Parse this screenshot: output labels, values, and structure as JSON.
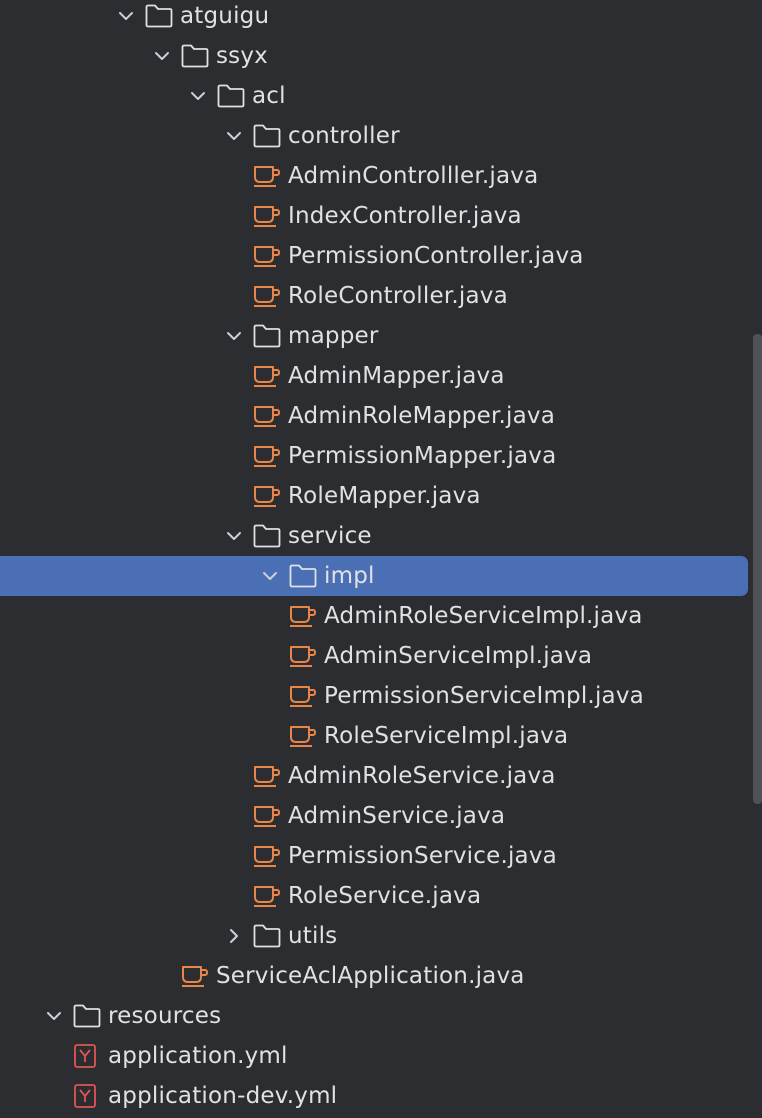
{
  "project_tree": {
    "items": [
      {
        "label": "atguigu",
        "type": "folder",
        "expanded": true,
        "depth": 3,
        "icon": "folder-icon",
        "name": "folder-atguigu"
      },
      {
        "label": "ssyx",
        "type": "folder",
        "expanded": true,
        "depth": 4,
        "icon": "folder-icon",
        "name": "folder-ssyx"
      },
      {
        "label": "acl",
        "type": "folder",
        "expanded": true,
        "depth": 5,
        "icon": "folder-icon",
        "name": "folder-acl"
      },
      {
        "label": "controller",
        "type": "folder",
        "expanded": true,
        "depth": 6,
        "icon": "folder-icon",
        "name": "folder-controller"
      },
      {
        "label": "AdminControlller.java",
        "type": "java",
        "depth": 7,
        "icon": "java-class-icon",
        "name": "file-admincontrolller"
      },
      {
        "label": "IndexController.java",
        "type": "java",
        "depth": 7,
        "icon": "java-class-icon",
        "name": "file-indexcontroller"
      },
      {
        "label": "PermissionController.java",
        "type": "java",
        "depth": 7,
        "icon": "java-class-icon",
        "name": "file-permissioncontroller"
      },
      {
        "label": "RoleController.java",
        "type": "java",
        "depth": 7,
        "icon": "java-class-icon",
        "name": "file-rolecontroller"
      },
      {
        "label": "mapper",
        "type": "folder",
        "expanded": true,
        "depth": 6,
        "icon": "folder-icon",
        "name": "folder-mapper"
      },
      {
        "label": "AdminMapper.java",
        "type": "java",
        "depth": 7,
        "icon": "java-class-icon",
        "name": "file-adminmapper"
      },
      {
        "label": "AdminRoleMapper.java",
        "type": "java",
        "depth": 7,
        "icon": "java-class-icon",
        "name": "file-adminrolemapper"
      },
      {
        "label": "PermissionMapper.java",
        "type": "java",
        "depth": 7,
        "icon": "java-class-icon",
        "name": "file-permissionmapper"
      },
      {
        "label": "RoleMapper.java",
        "type": "java",
        "depth": 7,
        "icon": "java-class-icon",
        "name": "file-rolemapper"
      },
      {
        "label": "service",
        "type": "folder",
        "expanded": true,
        "depth": 6,
        "icon": "folder-icon",
        "name": "folder-service"
      },
      {
        "label": "impl",
        "type": "folder",
        "expanded": true,
        "depth": 7,
        "icon": "folder-icon",
        "selected": true,
        "name": "folder-impl"
      },
      {
        "label": "AdminRoleServiceImpl.java",
        "type": "java",
        "depth": 8,
        "icon": "java-class-icon",
        "name": "file-adminroleserviceimpl"
      },
      {
        "label": "AdminServiceImpl.java",
        "type": "java",
        "depth": 8,
        "icon": "java-class-icon",
        "name": "file-adminserviceimpl"
      },
      {
        "label": "PermissionServiceImpl.java",
        "type": "java",
        "depth": 8,
        "icon": "java-class-icon",
        "name": "file-permissionserviceimpl"
      },
      {
        "label": "RoleServiceImpl.java",
        "type": "java",
        "depth": 8,
        "icon": "java-class-icon",
        "name": "file-roleserviceimpl"
      },
      {
        "label": "AdminRoleService.java",
        "type": "java",
        "depth": 7,
        "icon": "java-class-icon",
        "name": "file-adminroleservice"
      },
      {
        "label": "AdminService.java",
        "type": "java",
        "depth": 7,
        "icon": "java-class-icon",
        "name": "file-adminservice"
      },
      {
        "label": "PermissionService.java",
        "type": "java",
        "depth": 7,
        "icon": "java-class-icon",
        "name": "file-permissionservice"
      },
      {
        "label": "RoleService.java",
        "type": "java",
        "depth": 7,
        "icon": "java-class-icon",
        "name": "file-roleservice"
      },
      {
        "label": "utils",
        "type": "folder",
        "expanded": false,
        "depth": 6,
        "icon": "folder-icon",
        "name": "folder-utils"
      },
      {
        "label": "ServiceAclApplication.java",
        "type": "java",
        "depth": 5,
        "icon": "java-class-icon",
        "name": "file-serviceaclapplication"
      },
      {
        "label": "resources",
        "type": "folder",
        "expanded": true,
        "depth": 1,
        "icon": "folder-icon",
        "name": "folder-resources"
      },
      {
        "label": "application.yml",
        "type": "yaml",
        "depth": 2,
        "icon": "yaml-file-icon",
        "name": "file-application-yml"
      },
      {
        "label": "application-dev.yml",
        "type": "yaml",
        "depth": 2,
        "icon": "yaml-file-icon",
        "name": "file-application-dev-yml"
      }
    ]
  },
  "colors": {
    "background": "#2b2d30",
    "text": "#dfe1e5",
    "selection": "#4a6fb5",
    "java_icon": "#e8864a",
    "yaml_icon": "#e05555",
    "arrow": "#ced0d6"
  }
}
